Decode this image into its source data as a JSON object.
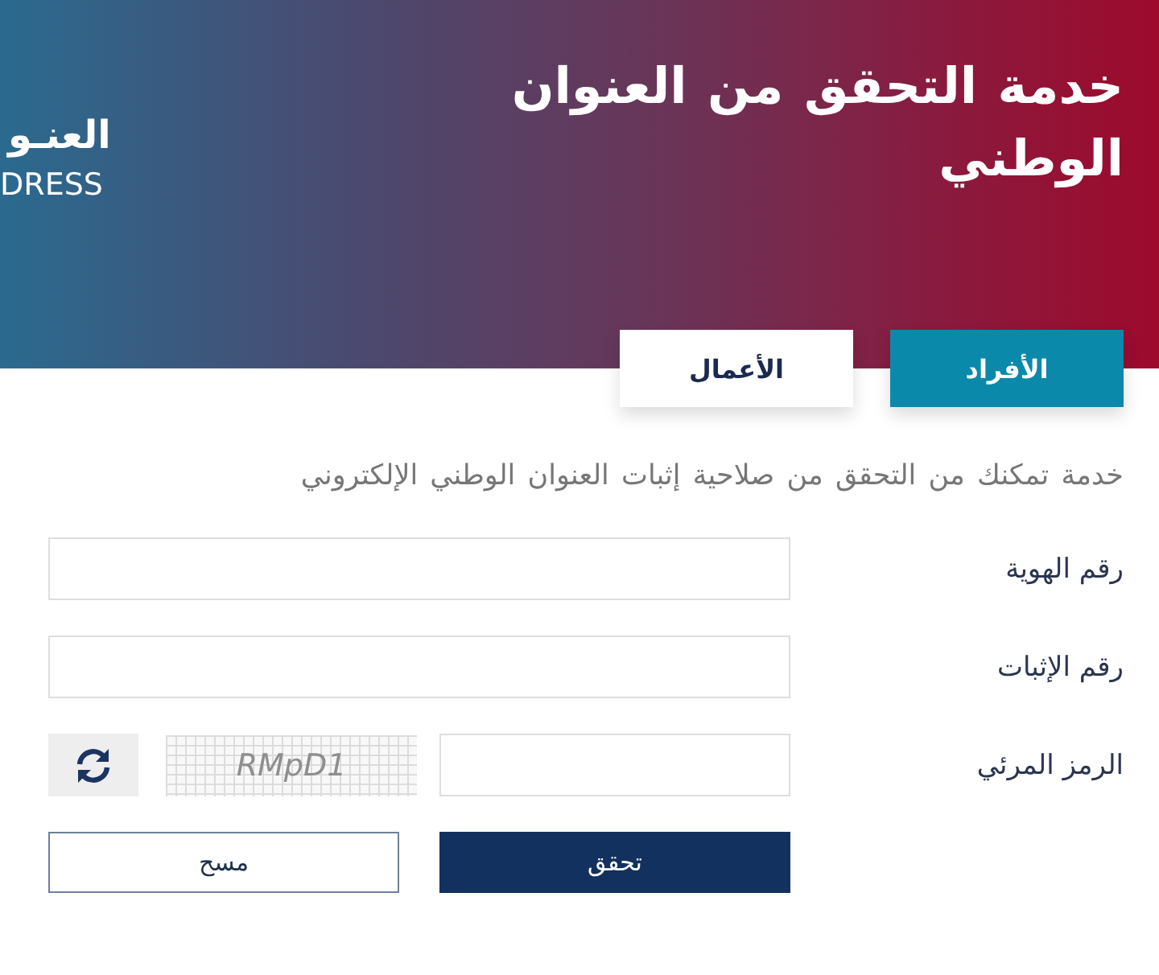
{
  "header": {
    "title": "خدمة التحقق من العنوان الوطني",
    "logo": {
      "arabic": "العنـو",
      "english": "DRESS"
    }
  },
  "tabs": [
    {
      "label": "الأفراد",
      "selected": true
    },
    {
      "label": "الأعمال",
      "selected": false
    }
  ],
  "description": "خدمة تمكنك من التحقق من صلاحية إثبات العنوان الوطني الإلكتروني",
  "form": {
    "fields": [
      {
        "kind": "text",
        "label": "رقم الهوية"
      },
      {
        "kind": "text",
        "label": "رقم الإثبات"
      },
      {
        "kind": "captcha",
        "label": "الرمز المرئي",
        "captcha_text": "RMpD1"
      }
    ]
  },
  "buttons": [
    {
      "kind": "primary",
      "label": "تحقق"
    },
    {
      "kind": "secondary",
      "label": "مسح"
    }
  ]
}
